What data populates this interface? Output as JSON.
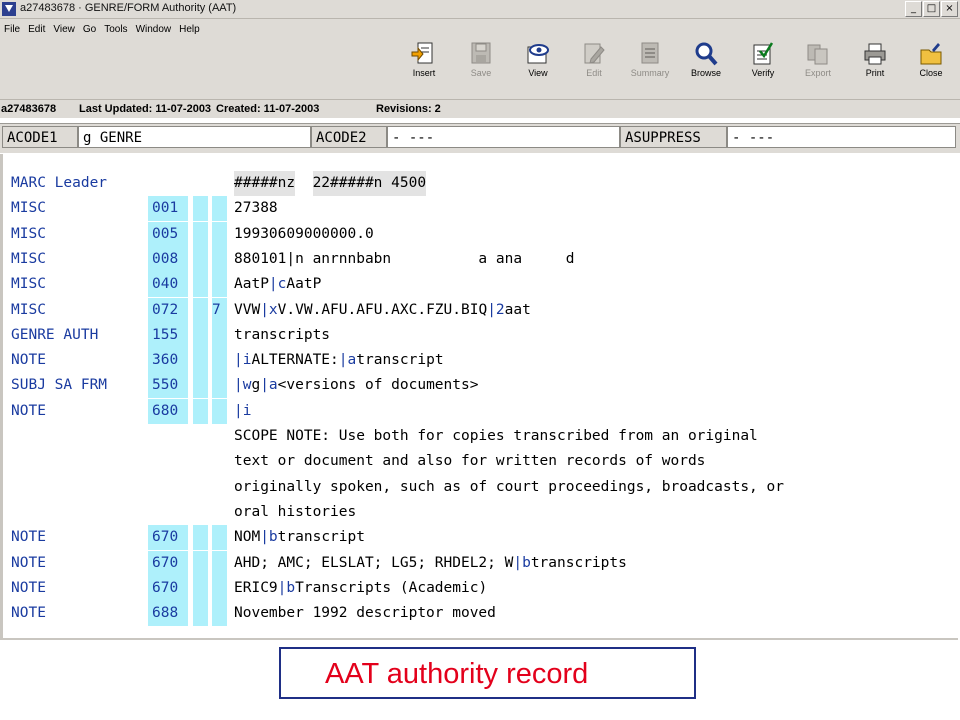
{
  "window": {
    "title": "a27483678 · GENRE/FORM Authority (AAT)",
    "controls": [
      "_",
      "□",
      "×"
    ]
  },
  "menu": [
    "File",
    "Edit",
    "View",
    "Go",
    "Tools",
    "Window",
    "Help"
  ],
  "toolbar": [
    {
      "label": "Insert",
      "icon": "insert-icon",
      "enabled": true
    },
    {
      "label": "Save",
      "icon": "save-icon",
      "enabled": false
    },
    {
      "label": "View",
      "icon": "view-icon",
      "enabled": true
    },
    {
      "label": "Edit",
      "icon": "edit-icon",
      "enabled": false
    },
    {
      "label": "Summary",
      "icon": "summary-icon",
      "enabled": false
    },
    {
      "label": "Browse",
      "icon": "browse-icon",
      "enabled": true
    },
    {
      "label": "Verify",
      "icon": "verify-icon",
      "enabled": true
    },
    {
      "label": "Export",
      "icon": "export-icon",
      "enabled": false
    },
    {
      "label": "Print",
      "icon": "print-icon",
      "enabled": true
    },
    {
      "label": "Close",
      "icon": "close-icon",
      "enabled": true
    }
  ],
  "record": {
    "id": "a27483678",
    "last_updated": "Last Updated: 11-07-2003",
    "created": "Created: 11-07-2003",
    "revisions": "Revisions: 2"
  },
  "fixed_fields": [
    {
      "label": "ACODE1",
      "value": "g GENRE"
    },
    {
      "label": "ACODE2",
      "value": "- ---"
    },
    {
      "label": "ASUPPRESS",
      "value": "- ---"
    }
  ],
  "leader": {
    "label": "MARC Leader",
    "parts": [
      "#####nz",
      "  ",
      "22#####n",
      " 4500"
    ]
  },
  "fields": [
    {
      "label": "MISC",
      "tag": "001",
      "ind1": "",
      "ind2": "",
      "data": [
        {
          "t": "27388"
        }
      ]
    },
    {
      "label": "MISC",
      "tag": "005",
      "ind1": "",
      "ind2": "",
      "data": [
        {
          "t": "19930609000000.0"
        }
      ]
    },
    {
      "label": "MISC",
      "tag": "008",
      "ind1": "",
      "ind2": "",
      "data": [
        {
          "t": "880101|n anrnnbabn          a ana     d"
        }
      ]
    },
    {
      "label": "MISC",
      "tag": "040",
      "ind1": "",
      "ind2": "",
      "data": [
        {
          "t": "AatP"
        },
        {
          "t": "|c",
          "d": true
        },
        {
          "t": "AatP"
        }
      ]
    },
    {
      "label": "MISC",
      "tag": "072",
      "ind1": "",
      "ind2": "7",
      "data": [
        {
          "t": "VVW"
        },
        {
          "t": "|x",
          "d": true
        },
        {
          "t": "V.VW.AFU.AFU.AXC.FZU.BIQ"
        },
        {
          "t": "|2",
          "d": true
        },
        {
          "t": "aat"
        }
      ]
    },
    {
      "label": "GENRE AUTH",
      "tag": "155",
      "ind1": "",
      "ind2": "",
      "data": [
        {
          "t": "transcripts"
        }
      ]
    },
    {
      "label": "NOTE",
      "tag": "360",
      "ind1": "",
      "ind2": "",
      "data": [
        {
          "t": "|i",
          "d": true
        },
        {
          "t": "ALTERNATE:"
        },
        {
          "t": "|a",
          "d": true
        },
        {
          "t": "transcript"
        }
      ]
    },
    {
      "label": "SUBJ SA FRM",
      "tag": "550",
      "ind1": "",
      "ind2": "",
      "data": [
        {
          "t": "|w",
          "d": true
        },
        {
          "t": "g"
        },
        {
          "t": "|a",
          "d": true
        },
        {
          "t": "<versions of documents>"
        }
      ]
    },
    {
      "label": "NOTE",
      "tag": "680",
      "ind1": "",
      "ind2": "",
      "data": [
        {
          "t": "|i",
          "d": true
        }
      ]
    },
    {
      "label": "",
      "tag": null,
      "data": [
        {
          "t": "SCOPE NOTE: Use both for copies transcribed from an original"
        }
      ]
    },
    {
      "label": "",
      "tag": null,
      "data": [
        {
          "t": "text or document and also for written records of words"
        }
      ]
    },
    {
      "label": "",
      "tag": null,
      "data": [
        {
          "t": "originally spoken, such as of court proceedings, broadcasts, or"
        }
      ]
    },
    {
      "label": "",
      "tag": null,
      "data": [
        {
          "t": "oral histories"
        }
      ]
    },
    {
      "label": "NOTE",
      "tag": "670",
      "ind1": "",
      "ind2": "",
      "data": [
        {
          "t": "NOM"
        },
        {
          "t": "|b",
          "d": true
        },
        {
          "t": "transcript"
        }
      ]
    },
    {
      "label": "NOTE",
      "tag": "670",
      "ind1": "",
      "ind2": "",
      "data": [
        {
          "t": "AHD; AMC; ELSLAT; LG5; RHDEL2; W"
        },
        {
          "t": "|b",
          "d": true
        },
        {
          "t": "transcripts"
        }
      ]
    },
    {
      "label": "NOTE",
      "tag": "670",
      "ind1": "",
      "ind2": "",
      "data": [
        {
          "t": "ERIC9"
        },
        {
          "t": "|b",
          "d": true
        },
        {
          "t": "Transcripts (Academic)"
        }
      ]
    },
    {
      "label": "NOTE",
      "tag": "688",
      "ind1": "",
      "ind2": "",
      "data": [
        {
          "t": "November 1992 descriptor moved"
        }
      ]
    }
  ],
  "caption": "AAT authority record",
  "colors": {
    "tag_bg": "#aef0fb",
    "label_text": "#1a3ba0",
    "caption_text": "#e3001b",
    "caption_border": "#1f2f86"
  }
}
